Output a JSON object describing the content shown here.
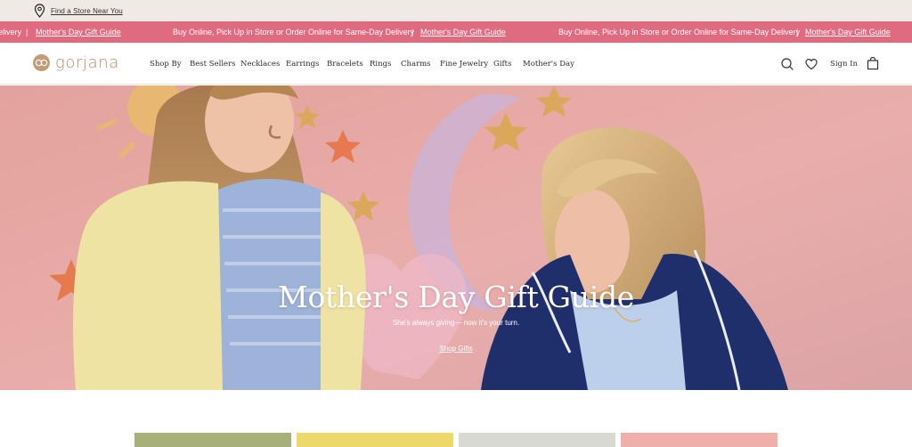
{
  "utility": {
    "store_link_label": "Find a Store Near You"
  },
  "promo": {
    "items": [
      {
        "text": "Buy Online, Pick Up in Store or Order Online for Same-Day Delivery"
      },
      {
        "link": "Mother's Day Gift Guide"
      }
    ],
    "leading_fragment": "elivery",
    "separator": "|"
  },
  "header": {
    "logo_text": "gorjana",
    "nav": [
      "Shop By",
      "Best Sellers",
      "Necklaces",
      "Earrings",
      "Bracelets",
      "Rings",
      "Charms",
      "Fine Jewelry",
      "Gifts",
      "Mother's Day"
    ],
    "sign_in_label": "Sign In"
  },
  "hero": {
    "title": "Mother's Day Gift Guide",
    "subtitle": "She's always giving— now it's your turn.",
    "cta_label": "Shop Gifts"
  },
  "colors": {
    "utility_bg": "#efebe4",
    "promo_bg": "#e06a80",
    "brand": "#b58f6c",
    "hero_bg": "#e6a6a0"
  },
  "icons": {
    "store": "location-pin-icon",
    "search": "search-icon",
    "wishlist": "heart-icon",
    "bag": "shopping-bag-icon"
  }
}
